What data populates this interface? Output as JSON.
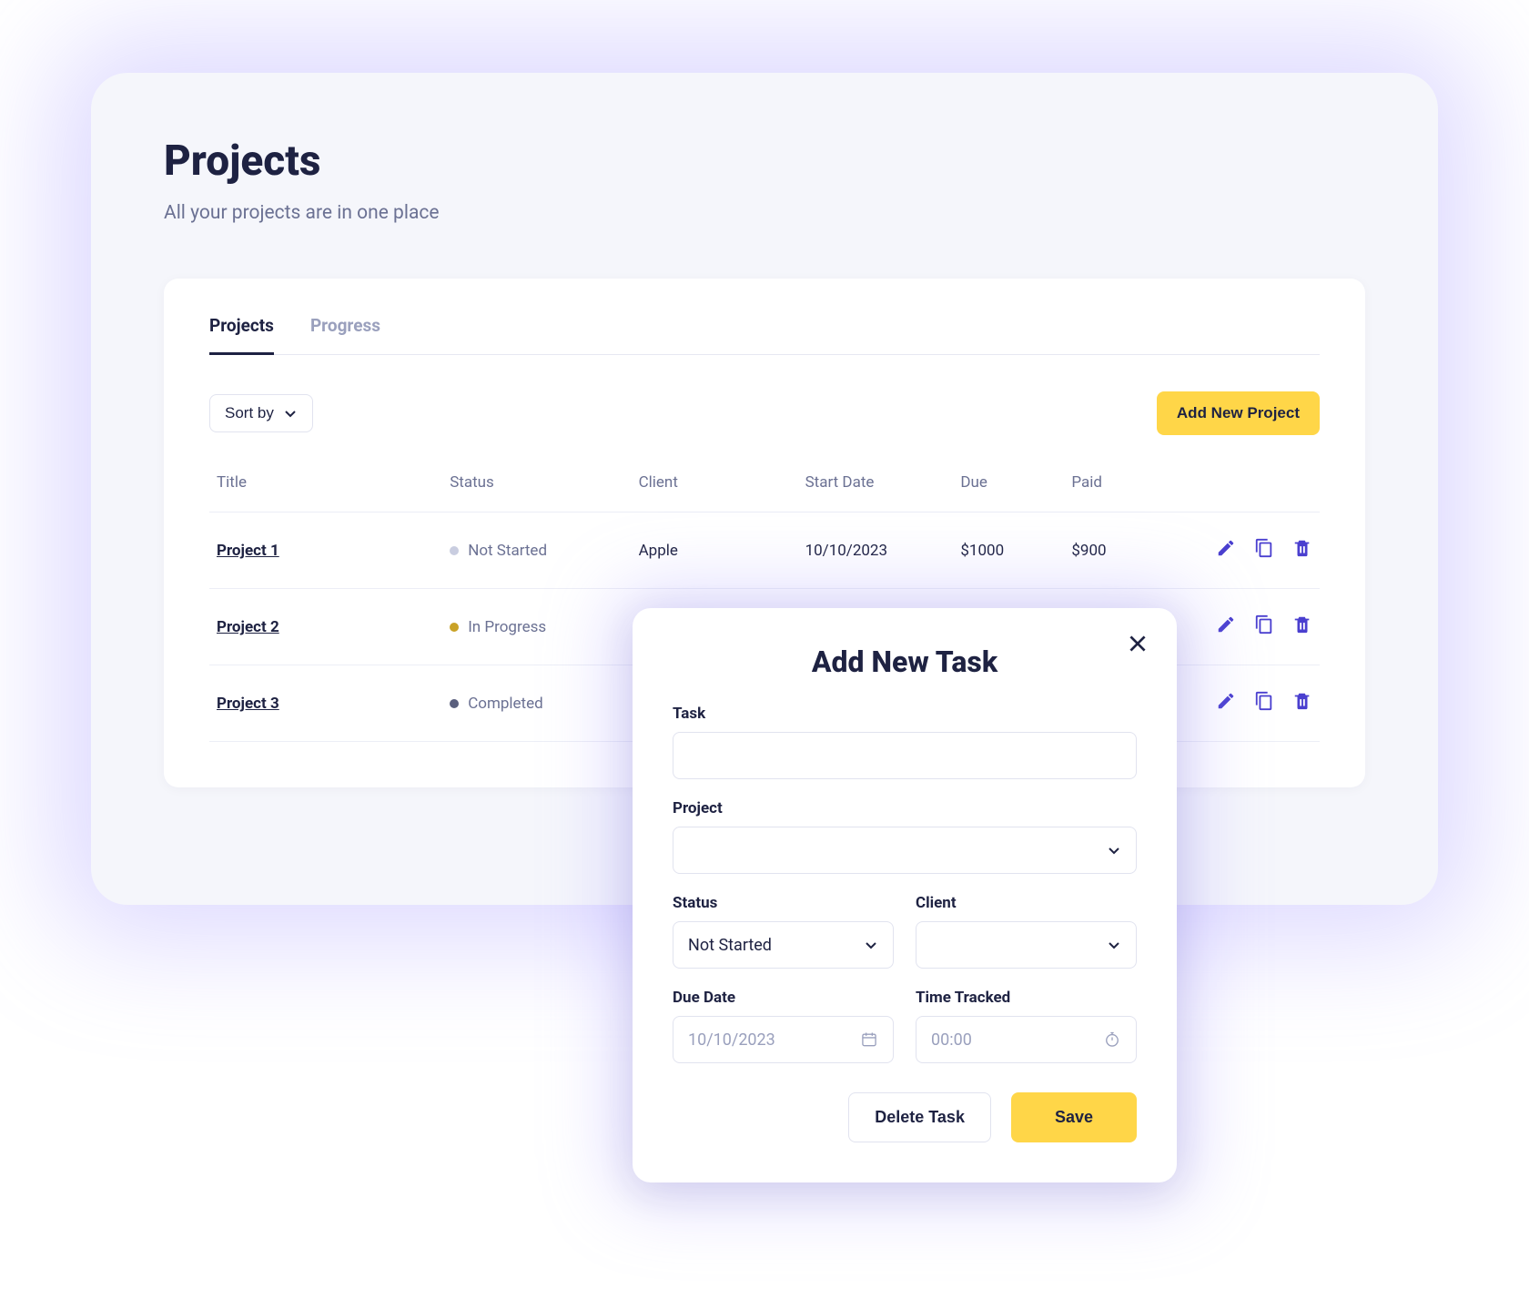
{
  "page": {
    "title": "Projects",
    "subtitle": "All your projects are in one place"
  },
  "tabs": [
    {
      "label": "Projects",
      "active": true
    },
    {
      "label": "Progress",
      "active": false
    }
  ],
  "toolbar": {
    "sort_label": "Sort by",
    "add_label": "Add New Project"
  },
  "table": {
    "headers": {
      "title": "Title",
      "status": "Status",
      "client": "Client",
      "start": "Start Date",
      "due": "Due",
      "paid": "Paid"
    },
    "rows": [
      {
        "title": "Project 1",
        "status": "Not Started",
        "status_kind": "grey",
        "client": "Apple",
        "start": "10/10/2023",
        "due": "$1000",
        "paid": "$900"
      },
      {
        "title": "Project 2",
        "status": "In Progress",
        "status_kind": "gold",
        "client": "",
        "start": "",
        "due": "",
        "paid": ""
      },
      {
        "title": "Project 3",
        "status": "Completed",
        "status_kind": "dark",
        "client": "",
        "start": "",
        "due": "",
        "paid": ""
      }
    ]
  },
  "modal": {
    "title": "Add New Task",
    "labels": {
      "task": "Task",
      "project": "Project",
      "status": "Status",
      "client": "Client",
      "due_date": "Due Date",
      "time_tracked": "Time Tracked"
    },
    "values": {
      "status": "Not Started"
    },
    "placeholders": {
      "due_date": "10/10/2023",
      "time_tracked": "00:00"
    },
    "buttons": {
      "delete": "Delete Task",
      "save": "Save"
    }
  },
  "colors": {
    "accent": "#ffd648",
    "icon": "#4a3fcf",
    "text": "#1e2242",
    "muted": "#6b7193"
  }
}
